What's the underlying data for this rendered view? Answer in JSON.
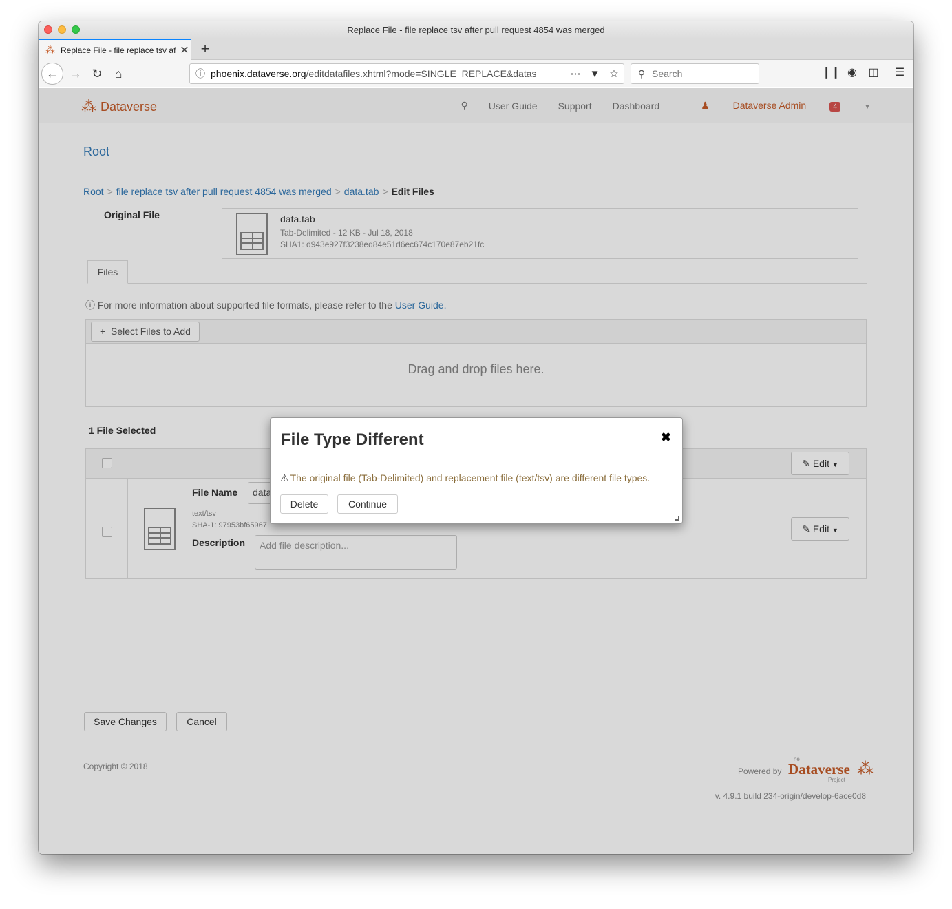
{
  "window": {
    "title": "Replace File - file replace tsv after pull request 4854 was merged"
  },
  "browser": {
    "tab_title": "Replace File - file replace tsv af",
    "url_domain": "phoenix.dataverse.org",
    "url_path": "/editdatafiles.xhtml?mode=SINGLE_REPLACE&datas",
    "search_placeholder": "Search"
  },
  "appnav": {
    "brand": "Dataverse",
    "links": [
      "User Guide",
      "Support",
      "Dashboard"
    ],
    "user": "Dataverse Admin",
    "notifications": "4"
  },
  "page": {
    "root_title": "Root",
    "breadcrumb": {
      "root": "Root",
      "dataset": "file replace tsv after pull request 4854 was merged",
      "file": "data.tab",
      "current": "Edit Files",
      "separator": ">"
    },
    "original_file": {
      "label": "Original File",
      "name": "data.tab",
      "meta": "Tab-Delimited - 12 KB - Jul 18, 2018",
      "sha": "SHA1: d943e927f3238ed84e51d6ec674c170e87eb21fc"
    },
    "files_tab": "Files",
    "help": {
      "text": "For more information about supported file formats, please refer to the",
      "link": "User Guide."
    },
    "select_files": "Select Files to Add",
    "drop_text": "Drag and drop files here.",
    "selected_count": "1 File Selected",
    "edit_label": "Edit",
    "row": {
      "file_name_label": "File Name",
      "file_name_value": "data.",
      "type": "text/tsv",
      "sha": "SHA-1: 97953bf65967",
      "description_label": "Description",
      "description_placeholder": "Add file description..."
    },
    "save_changes": "Save Changes",
    "cancel": "Cancel"
  },
  "footer": {
    "copyright": "Copyright © 2018",
    "powered_by": "Powered by",
    "logo_the": "The",
    "logo_name": "Dataverse",
    "logo_project": "Project",
    "version": "v. 4.9.1 build 234-origin/develop-6ace0d8"
  },
  "modal": {
    "title": "File Type Different",
    "message": "The original file (Tab-Delimited) and replacement file (text/tsv) are different file types.",
    "delete_label": "Delete",
    "continue_label": "Continue"
  }
}
